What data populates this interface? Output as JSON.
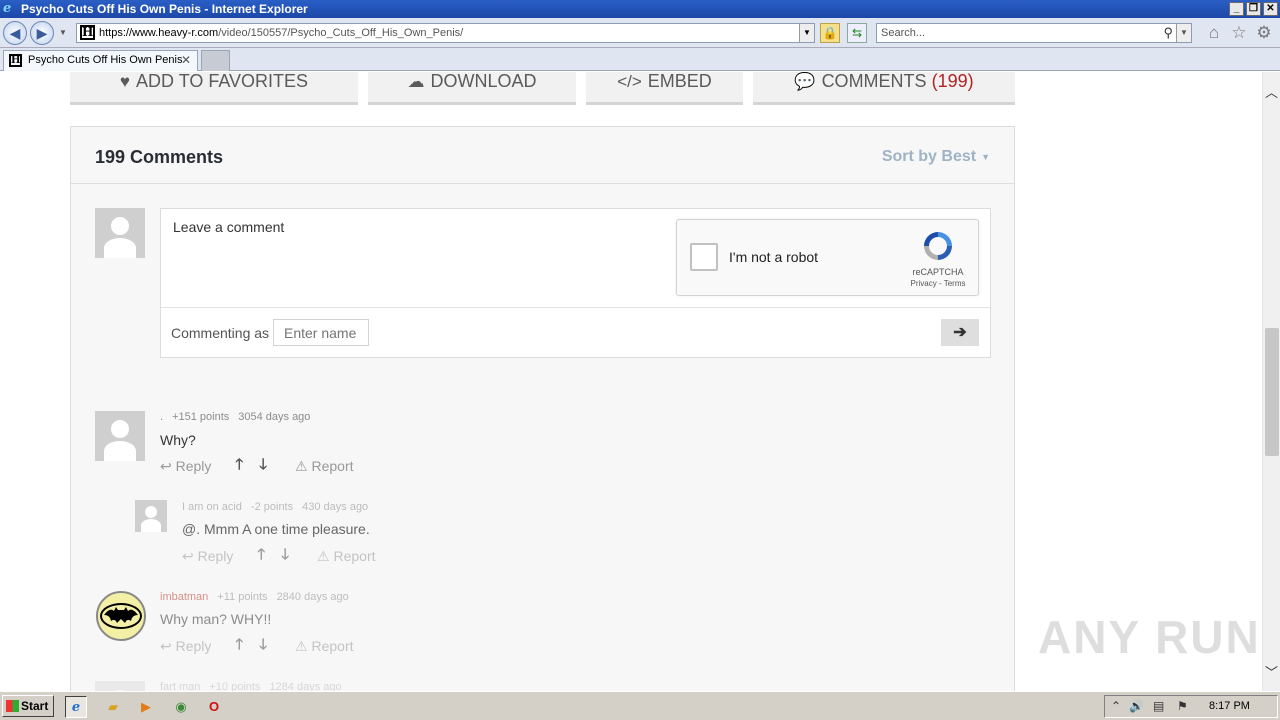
{
  "window": {
    "title": "Psycho Cuts Off His Own Penis - Internet Explorer",
    "url_scheme_host": "https://www.heavy-r.com",
    "url_path": "/video/150557/Psycho_Cuts_Off_His_Own_Penis/",
    "search_placeholder": "Search...",
    "tab_title": "Psycho Cuts Off His Own Penis",
    "favicon_letter": "H"
  },
  "actions": {
    "favorites_label": "ADD TO FAVORITES",
    "download_label": "DOWNLOAD",
    "embed_label": "EMBED",
    "comments_label": "COMMENTS",
    "comments_count": "(199)"
  },
  "comments": {
    "heading": "199 Comments",
    "sort_label": "Sort by Best",
    "editor_placeholder": "Leave a comment",
    "recaptcha_label": "I'm not a robot",
    "recaptcha_brand": "reCAPTCHA",
    "recaptcha_links": "Privacy - Terms",
    "commenting_as": "Commenting as",
    "name_placeholder": "Enter name",
    "reply_label": "Reply",
    "report_label": "Report",
    "items": [
      {
        "author": ".",
        "points": "+151 points",
        "age": "3054 days ago",
        "text": "Why?"
      },
      {
        "author": "I am on acid",
        "points": "-2 points",
        "age": "430 days ago",
        "text": "@. Mmm A one time pleasure."
      },
      {
        "author": "imbatman",
        "points": "+11 points",
        "age": "2840 days ago",
        "text": "Why man? WHY!!"
      },
      {
        "author": "fart man",
        "points": "+10 points",
        "age": "1284 days ago"
      }
    ]
  },
  "watermark": "ANY RUN",
  "taskbar": {
    "start_label": "Start",
    "clock": "8:17 PM"
  }
}
